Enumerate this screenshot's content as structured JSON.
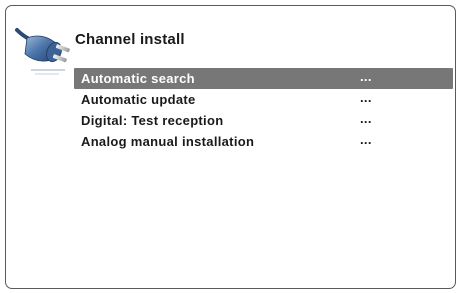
{
  "screen": {
    "title": "Channel install",
    "icon": "plug-icon"
  },
  "menu": {
    "items": [
      {
        "label": "Automatic search",
        "value": "...",
        "selected": true
      },
      {
        "label": "Automatic update",
        "value": "...",
        "selected": false
      },
      {
        "label": "Digital: Test reception",
        "value": "...",
        "selected": false
      },
      {
        "label": "Analog manual installation",
        "value": "...",
        "selected": false
      }
    ]
  },
  "colors": {
    "highlight": "#777777",
    "text": "#1a1a1a",
    "frame": "#5a5a5a"
  }
}
